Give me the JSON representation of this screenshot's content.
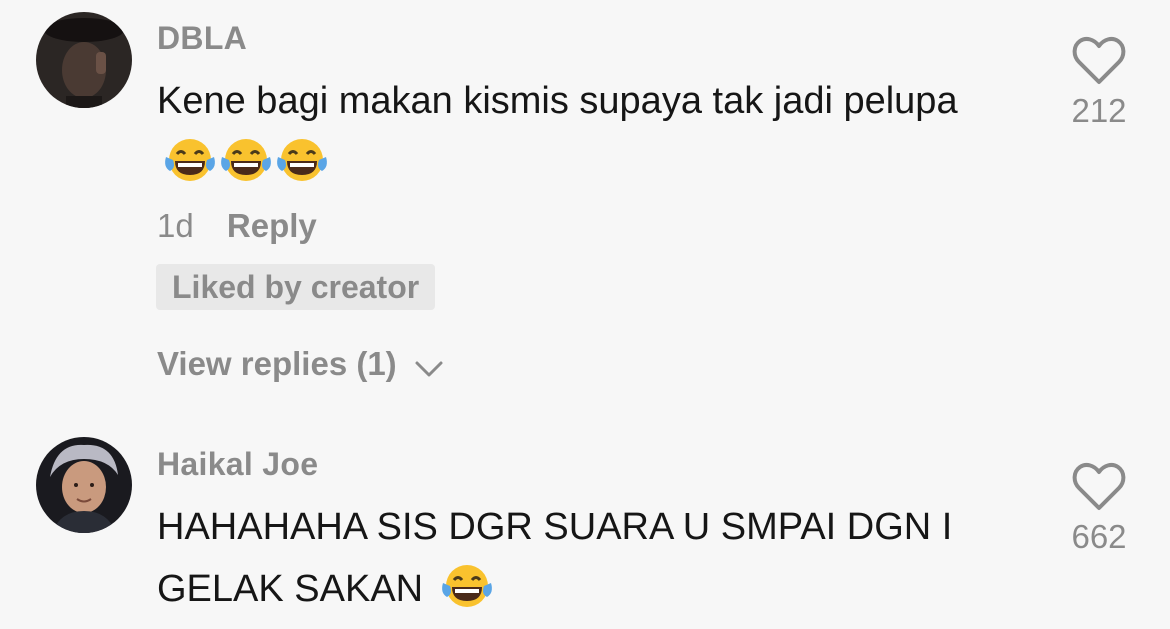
{
  "comments": [
    {
      "username": "DBLA",
      "text": "Kene bagi makan kismis supaya tak jadi pelupa",
      "emojis": [
        "😂",
        "😂",
        "😂"
      ],
      "time": "1d",
      "reply_label": "Reply",
      "badge": "Liked by creator",
      "view_replies": "View replies (1)",
      "likes": "212"
    },
    {
      "username": "Haikal Joe",
      "text": "HAHAHAHA SIS DGR SUARA U SMPAI DGN I GELAK SAKAN",
      "emojis": [
        "😂"
      ],
      "likes": "662"
    }
  ],
  "icons": {
    "like": "heart-outline-icon",
    "expand": "chevron-down-icon",
    "emoji": "face-with-tears-of-joy-icon"
  },
  "colors": {
    "background": "#f7f7f7",
    "primary_text": "#161616",
    "secondary_text": "#8a8a8a",
    "badge_background": "#e8e8e8",
    "emoji_yellow": "#f9c22e",
    "emoji_tears": "#5aa5e6"
  }
}
